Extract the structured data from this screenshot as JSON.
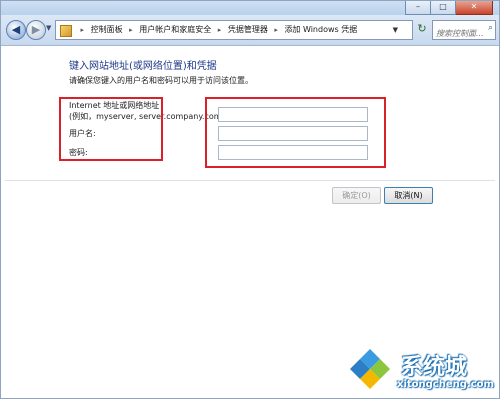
{
  "window": {
    "caption_buttons": [
      {
        "name": "minimize",
        "glyph": "–"
      },
      {
        "name": "maximize",
        "glyph": "□"
      },
      {
        "name": "close",
        "glyph": "✕"
      }
    ]
  },
  "nav": {
    "back_glyph": "◀",
    "forward_glyph": "▶",
    "breadcrumbs": [
      "控制面板",
      "用户帐户和家庭安全",
      "凭据管理器",
      "添加 Windows 凭据"
    ],
    "separator": "▸",
    "refresh_glyph": "↻",
    "search_placeholder": "搜索控制面...",
    "search_icon": "search-icon"
  },
  "form": {
    "heading": "键入网站地址(或网络位置)和凭据",
    "description": "请确保您键入的用户名和密码可以用于访问该位置。",
    "address_label": "Internet 地址或网络地址",
    "address_example": "(例如，myserver, server.company.com):",
    "username_label": "用户名:",
    "password_label": "密码:",
    "address_value": "",
    "username_value": "",
    "password_value": ""
  },
  "buttons": {
    "ok_label": "确定(O)",
    "cancel_label": "取消(N)"
  },
  "annotations": {
    "highlight_color": "#d9212b"
  },
  "watermark": {
    "name": "系统城",
    "url": "xitongcheng.com"
  }
}
